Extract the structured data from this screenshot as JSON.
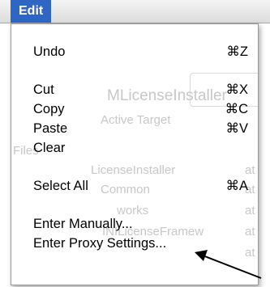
{
  "menubar": {
    "active_menu": "Edit",
    "highlight_color": "#2f66c4"
  },
  "menu": {
    "groups": [
      [
        {
          "label": "Undo",
          "shortcut": "⌘Z"
        }
      ],
      [
        {
          "label": "Cut",
          "shortcut": "⌘X"
        },
        {
          "label": "Copy",
          "shortcut": "⌘C"
        },
        {
          "label": "Paste",
          "shortcut": "⌘V"
        },
        {
          "label": "Clear",
          "shortcut": ""
        }
      ],
      [
        {
          "label": "Select All",
          "shortcut": "⌘A"
        }
      ],
      [
        {
          "label": "Enter Manually...",
          "shortcut": ""
        },
        {
          "label": "Enter Proxy Settings...",
          "shortcut": ""
        }
      ]
    ]
  },
  "background_ghost": {
    "window_title": "MLicenseInstaller",
    "toolbar_label": "Active Target",
    "group_header": "Files",
    "tree_items": [
      "LicenseInstaller",
      "Common",
      "works",
      "INILicenseFramew"
    ],
    "side_marks": [
      "at",
      "at",
      "at",
      "at",
      "at"
    ]
  },
  "annotation": {
    "icon": "arrow-icon",
    "color": "#000000"
  }
}
